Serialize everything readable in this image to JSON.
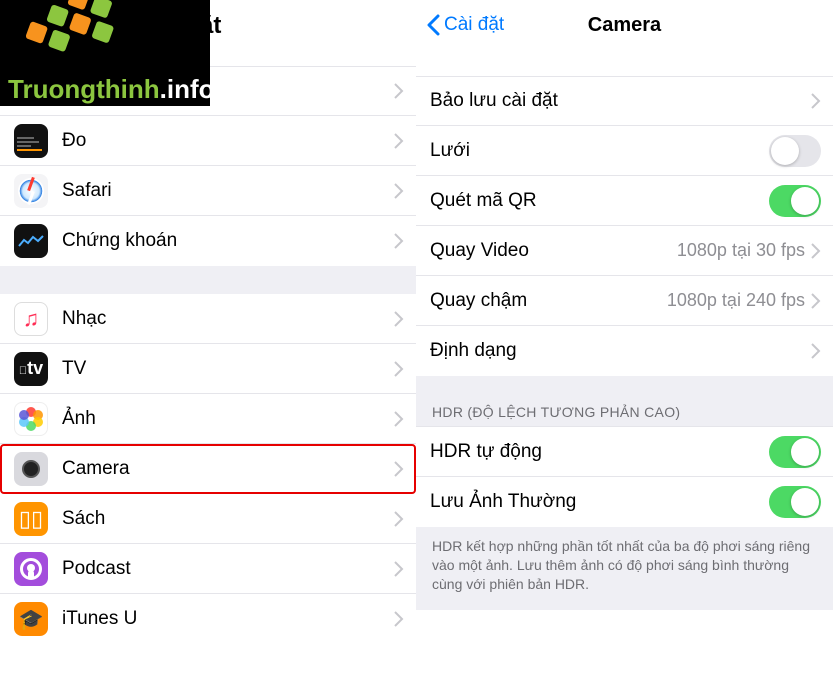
{
  "logo": {
    "brand1": "Truongthinh",
    "brand2": ".info"
  },
  "left": {
    "title_fragment": "ặt",
    "group1": [
      {
        "label": "Đo"
      },
      {
        "label": "Safari"
      },
      {
        "label": "Chứng khoán"
      }
    ],
    "group2": [
      {
        "label": "Nhạc"
      },
      {
        "label": "TV"
      },
      {
        "label": "Ảnh"
      },
      {
        "label": "Camera",
        "highlight": true
      },
      {
        "label": "Sách"
      },
      {
        "label": "Podcast"
      },
      {
        "label": "iTunes U"
      }
    ]
  },
  "right": {
    "back_label": "Cài đặt",
    "title": "Camera",
    "rows": {
      "preserve": {
        "label": "Bảo lưu cài đặt"
      },
      "grid": {
        "label": "Lưới",
        "on": false
      },
      "qr": {
        "label": "Quét mã QR",
        "on": true
      },
      "video": {
        "label": "Quay Video",
        "value": "1080p tại 30 fps"
      },
      "slowmo": {
        "label": "Quay chậm",
        "value": "1080p tại 240 fps"
      },
      "format": {
        "label": "Định dạng"
      }
    },
    "hdr_section": "HDR (ĐỘ LỆCH TƯƠNG PHẢN CAO)",
    "hdr": {
      "auto": {
        "label": "HDR tự động",
        "on": true
      },
      "keep": {
        "label": "Lưu Ảnh Thường",
        "on": true
      }
    },
    "footer": "HDR kết hợp những phần tốt nhất của ba độ phơi sáng riêng vào một ảnh. Lưu thêm ảnh có độ phơi sáng bình thường cùng với phiên bản HDR."
  }
}
